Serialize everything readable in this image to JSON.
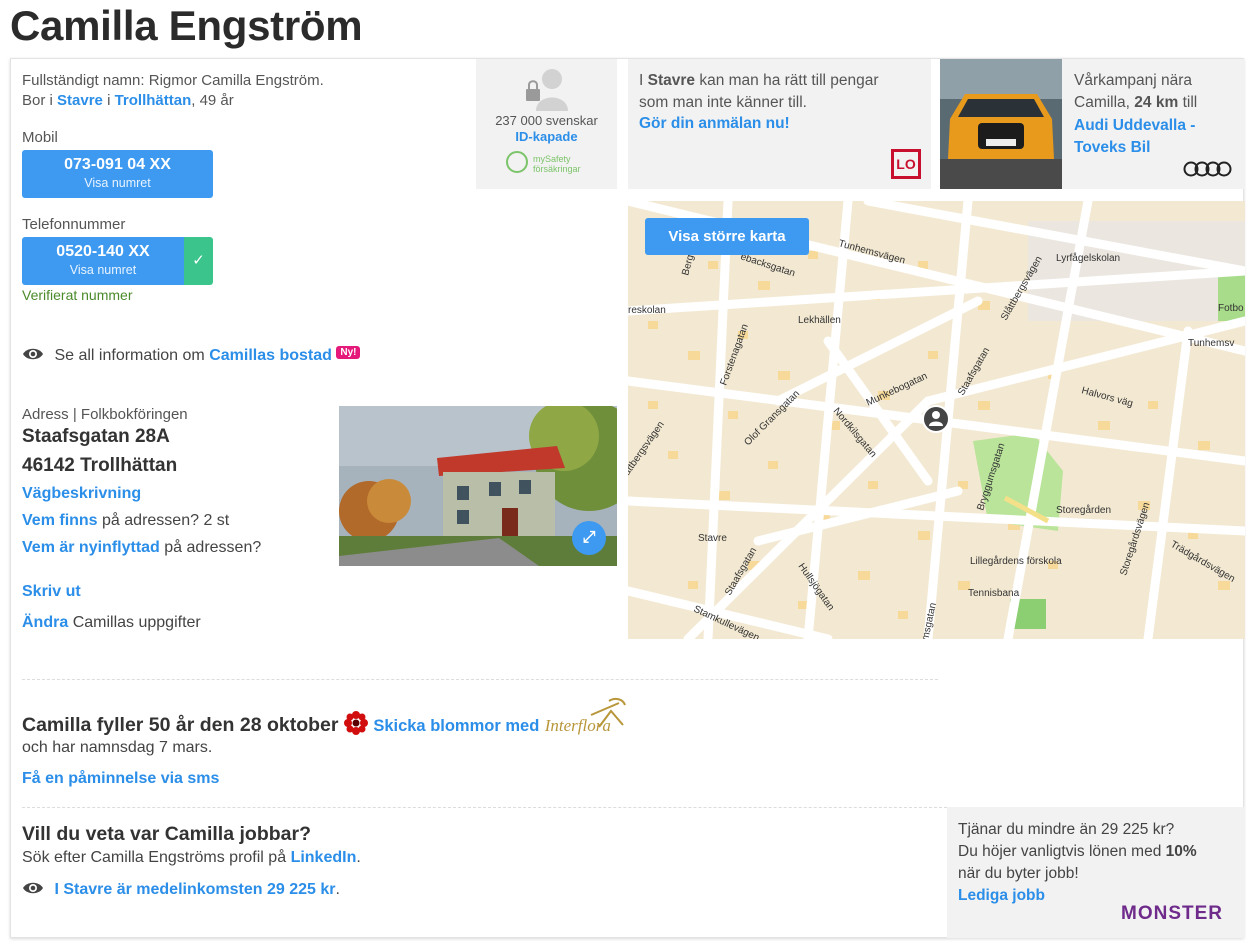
{
  "page": {
    "title": "Camilla Engström"
  },
  "person": {
    "full_name_label": "Fullständigt namn: Rigmor Camilla Engström.",
    "lives_prefix": "Bor i",
    "district": "Stavre",
    "in": "i",
    "city": "Trollhättan",
    "age": ", 49 år"
  },
  "mobile": {
    "label": "Mobil",
    "number": "073-091 04 XX",
    "show": "Visa numret"
  },
  "phone": {
    "label": "Telefonnummer",
    "number": "0520-140 XX",
    "show": "Visa numret",
    "verified": "Verifierat nummer",
    "check": "✓"
  },
  "housing": {
    "prefix": "Se all information om",
    "link": "Camillas bostad",
    "badge": "Ny!"
  },
  "address": {
    "label": "Adress | Folkbokföringen",
    "street": "Staafsgatan 28A",
    "postal": "46142 Trollhättan",
    "directions": "Vägbeskrivning",
    "who_link": "Vem finns",
    "who_rest": "på adressen? 2 st",
    "new_link": "Vem är nyinflyttad",
    "new_rest": "på adressen?",
    "print": "Skriv ut",
    "edit_link": "Ändra",
    "edit_rest": "Camillas uppgifter"
  },
  "id_ad": {
    "count": "237 000 svenskar",
    "link": "ID-kapade",
    "brand_line1": "mySafety",
    "brand_line2": "försäkringar"
  },
  "lo_ad": {
    "pre": "I",
    "place": "Stavre",
    "rest": "kan man ha rätt till pengar som man inte känner till.",
    "link": "Gör din anmälan nu!",
    "logo": "LO"
  },
  "audi_ad": {
    "line1": "Vårkampanj nära",
    "line2_pre": "Camilla,",
    "distance": "24 km",
    "line2_post": "till",
    "link": "Audi Uddevalla - Toveks Bil",
    "plate": "IN-O 8065"
  },
  "map": {
    "button": "Visa större karta",
    "labels": [
      "Tunhemsvägen",
      "Lyrfågelskolan",
      "Fotbo",
      "Tunhemsv",
      "Slåttbergsvägen",
      "Lekhällen",
      "Halvors väg",
      "Munkebogatan",
      "Staafsgatan",
      "Forstenagatan",
      "Olof Gransgatan",
      "Nordkilsgatan",
      "attbergsvägen",
      "Bryggumsgatan",
      "Storegården",
      "Stavre",
      "Lillegårdens förskola",
      "Tennisbana",
      "Hullsjögatan",
      "Staafsgatan",
      "Stamkullevägen",
      "Storegårdsvägen",
      "Trädgårdsvägen",
      "reskolan",
      "Berg",
      "ebacksgatan",
      "msgatan"
    ]
  },
  "birthday": {
    "title": "Camilla fyller 50 år den 28 oktober",
    "flower_link": "Skicka blommor med",
    "brand": "Interflora",
    "nameday": "och har namnsdag 7 mars.",
    "reminder": "Få en påminnelse via sms"
  },
  "work": {
    "title": "Vill du veta var Camilla jobbar?",
    "search_pre": "Sök efter Camilla Engströms profil på",
    "linkedin": "LinkedIn",
    "search_post": ".",
    "income_link": "I Stavre är medelinkomsten 29 225 kr",
    "income_post": "."
  },
  "monster_ad": {
    "line1": "Tjänar du mindre än 29 225 kr?",
    "line2_pre": "Du höjer vanligtvis lönen med",
    "pct": "10%",
    "line3": "när du byter jobb!",
    "link": "Lediga jobb",
    "brand": "MONSTER"
  },
  "colors": {
    "accent": "#2b8ee8",
    "button": "#3d9af0",
    "verified": "#3bc48b",
    "badge": "#e5197a"
  }
}
